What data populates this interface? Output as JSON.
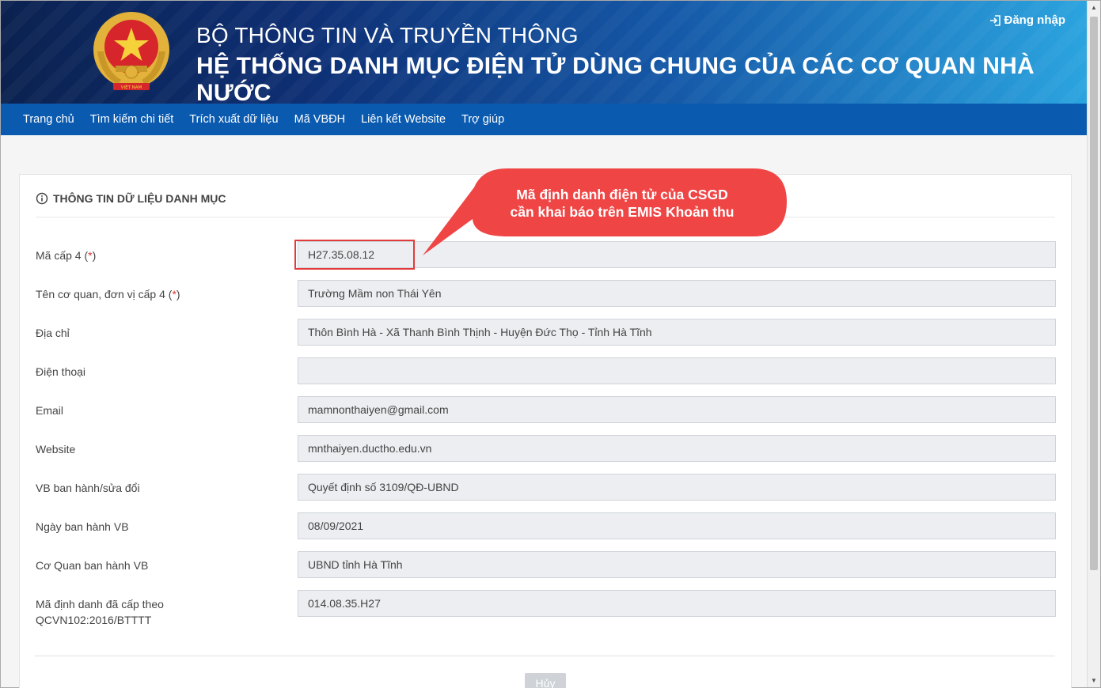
{
  "header": {
    "ministry": "BỘ THÔNG TIN VÀ TRUYỀN THÔNG",
    "system": "HỆ THỐNG DANH MỤC ĐIỆN TỬ DÙNG CHUNG CỦA CÁC CƠ QUAN NHÀ NƯỚC",
    "login_label": "Đăng nhập",
    "emblem_text": "VIỆT NAM"
  },
  "nav": {
    "items": [
      "Trang chủ",
      "Tìm kiếm chi tiết",
      "Trích xuất dữ liệu",
      "Mã VBĐH",
      "Liên kết Website",
      "Trợ giúp"
    ]
  },
  "panel": {
    "title": "THÔNG TIN DỮ LIỆU DANH MỤC",
    "required_mark": "*",
    "fields": [
      {
        "label": "Mã cấp 4",
        "required": true,
        "value": "H27.35.08.12"
      },
      {
        "label": "Tên cơ quan, đơn vị cấp 4",
        "required": true,
        "value": "Trường Mầm non Thái Yên"
      },
      {
        "label": "Địa chỉ",
        "required": false,
        "value": "Thôn Bình Hà - Xã Thanh Bình Thịnh - Huyện Đức Thọ - Tỉnh Hà Tĩnh"
      },
      {
        "label": "Điện thoại",
        "required": false,
        "value": ""
      },
      {
        "label": "Email",
        "required": false,
        "value": "mamnonthaiyen@gmail.com"
      },
      {
        "label": "Website",
        "required": false,
        "value": "mnthaiyen.ductho.edu.vn"
      },
      {
        "label": "VB ban hành/sửa đổi",
        "required": false,
        "value": "Quyết định số 3109/QĐ-UBND"
      },
      {
        "label": "Ngày ban hành VB",
        "required": false,
        "value": "08/09/2021"
      },
      {
        "label": "Cơ Quan ban hành VB",
        "required": false,
        "value": "UBND tỉnh Hà Tĩnh"
      },
      {
        "label": "Mã định danh đã cấp theo QCVN102:2016/BTTTT",
        "required": false,
        "value": "014.08.35.H27"
      }
    ],
    "cancel_label": "Hủy"
  },
  "callout": {
    "line1": "Mã định danh điện tử của CSGD",
    "line2": "cần khai báo trên EMIS Khoản thu"
  },
  "colors": {
    "nav_bg": "#0a5ab0",
    "callout_bg": "#f04545",
    "highlight_border": "#e33b3b"
  }
}
